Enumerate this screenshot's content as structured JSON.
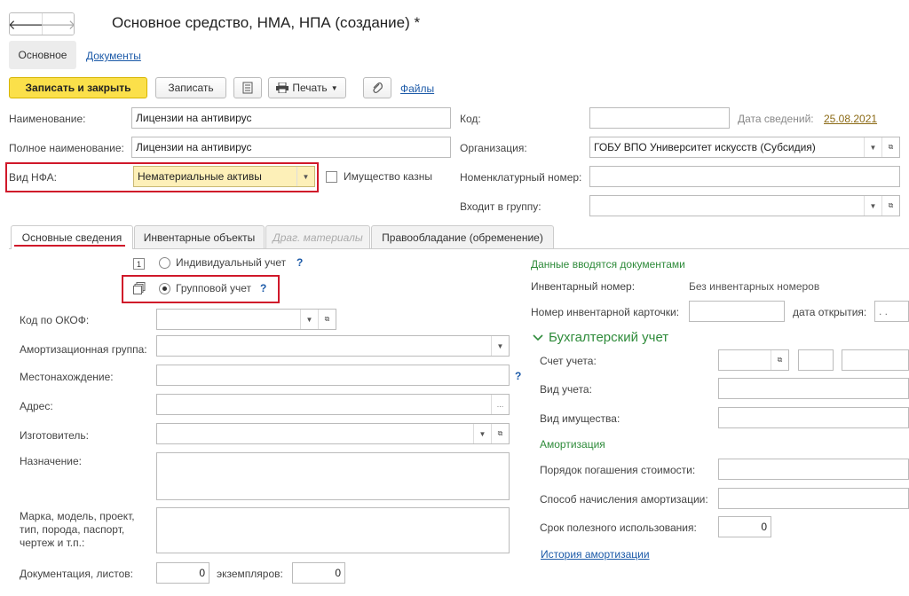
{
  "window": {
    "title": "Основное средство, НМА, НПА (создание) *",
    "back_glyph": "🡐",
    "forward_glyph": "🡒"
  },
  "top_tabs": {
    "main": "Основное",
    "documents": "Документы"
  },
  "toolbar": {
    "save_close": "Записать и закрыть",
    "save": "Записать",
    "print": "Печать",
    "files": "Файлы"
  },
  "header_fields": {
    "name_label": "Наименование:",
    "name_value": "Лицензии на антивирус",
    "full_name_label": "Полное наименование:",
    "full_name_value": "Лицензии на антивирус",
    "nfa_type_label": "Вид НФА:",
    "nfa_type_value": "Нематериальные активы",
    "treasury_property_label": "Имущество казны",
    "code_label": "Код:",
    "code_value": "",
    "info_date_label": "Дата сведений:",
    "info_date_value": "25.08.2021",
    "org_label": "Организация:",
    "org_value": "ГОБУ ВПО Университет искусств (Субсидия)",
    "nomenclature_label": "Номенклатурный номер:",
    "nomenclature_value": "",
    "group_label": "Входит в группу:",
    "group_value": ""
  },
  "tabs": {
    "basic": "Основные сведения",
    "inventory": "Инвентарные объекты",
    "precious": "Драг. материалы",
    "rights": "Правообладание (обременение)"
  },
  "left": {
    "individual_index": "1",
    "individual_label": "Индивидуальный учет",
    "group_accounting_label": "Групповой учет",
    "help_mark": "?",
    "okof_label": "Код по ОКОФ:",
    "amort_group_label": "Амортизационная группа:",
    "location_label": "Местонахождение:",
    "address_label": "Адрес:",
    "manufacturer_label": "Изготовитель:",
    "purpose_label": "Назначение:",
    "brand_label_1": "Марка, модель, проект,",
    "brand_label_2": "тип, порода, паспорт,",
    "brand_label_3": "чертеж и т.п.:",
    "docs_label": "Документация, листов:",
    "docs_value": "0",
    "copies_label": "экземпляров:",
    "copies_value": "0"
  },
  "right": {
    "docs_entered": "Данные вводятся документами",
    "inv_number_label": "Инвентарный номер:",
    "inv_number_value": "Без инвентарных номеров",
    "inv_card_label": "Номер инвентарной карточки:",
    "open_date_label": "дата открытия:",
    "open_date_value": ". .",
    "accounting_section": "Бухгалтерский учет",
    "account_label": "Счет учета:",
    "account_type_label": "Вид учета:",
    "property_type_label": "Вид имущества:",
    "amortization_section": "Амортизация",
    "repayment_label": "Порядок погашения стоимости:",
    "method_label": "Способ начисления амортизации:",
    "useful_life_label": "Срок полезного использования:",
    "useful_life_value": "0",
    "history_link": "История амортизации"
  },
  "colors": {
    "accent_yellow": "#fbe04a",
    "highlight_red": "#d0182a",
    "section_green": "#2e8b3a",
    "link_blue": "#1c5aa8"
  }
}
